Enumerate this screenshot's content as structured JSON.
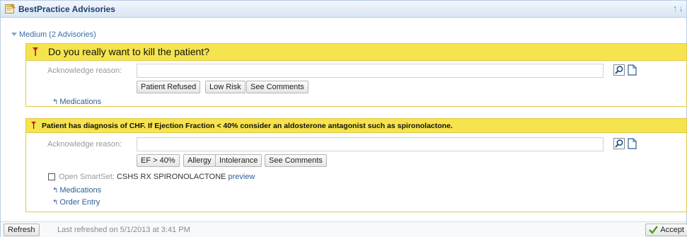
{
  "window": {
    "title": "BestPractice Advisories",
    "title_icon": "advisory-app-icon",
    "nav_arrows": "↑↓"
  },
  "group": {
    "label": "Medium (2 Advisories)"
  },
  "advisories": [
    {
      "message": "Do you really want to kill the patient?",
      "ack_label": "Acknowledge reason:",
      "ack_value": "",
      "reasons": [
        "Patient Refused",
        "Low Risk",
        "See Comments"
      ],
      "links": [
        "Medications"
      ]
    },
    {
      "message": "Patient has diagnosis of CHF. If Ejection Fraction < 40% consider an aldosterone antagonist such as spironolactone.",
      "ack_label": "Acknowledge reason:",
      "ack_value": "",
      "reasons": [
        "EF > 40%",
        "Allergy",
        "Intolerance",
        "See Comments"
      ],
      "smartset": {
        "prefix": "Open SmartSet:",
        "name": "CSHS RX SPIRONOLACTONE",
        "preview": "preview",
        "checked": false
      },
      "links": [
        "Medications",
        "Order Entry"
      ]
    }
  ],
  "footer": {
    "refresh_label": "Refresh",
    "last_refreshed": "Last refreshed on 5/1/2013 at 3:41 PM",
    "accept_label": "Accept"
  },
  "colors": {
    "titlebar": "#d9e6f4",
    "advisory_header": "#f5e44d",
    "advisory_border": "#e3c84a",
    "link": "#2f5f99",
    "accept_check": "#4a9a2a"
  }
}
